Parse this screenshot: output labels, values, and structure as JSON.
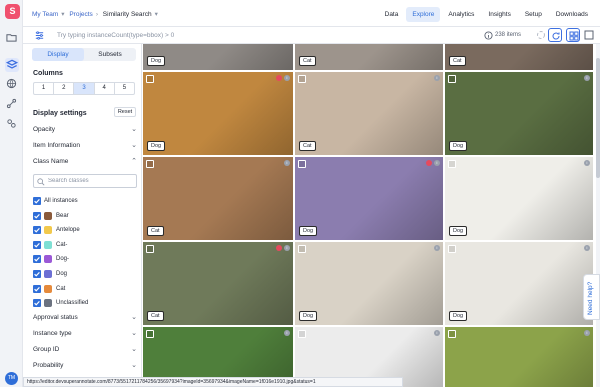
{
  "app": {
    "logo_letter": "S",
    "avatar_initials": "TM"
  },
  "rail": {
    "icons": [
      "folder-icon",
      "layers-icon",
      "globe-icon",
      "workflow-icon",
      "integrations-icon"
    ]
  },
  "breadcrumb": {
    "team": "My Team",
    "projects": "Projects",
    "current": "Similarity Search"
  },
  "tabs": [
    {
      "label": "Data",
      "active": false
    },
    {
      "label": "Explore",
      "active": true
    },
    {
      "label": "Analytics",
      "active": false
    },
    {
      "label": "Insights",
      "active": false
    },
    {
      "label": "Setup",
      "active": false
    },
    {
      "label": "Downloads",
      "active": false
    }
  ],
  "query": {
    "placeholder": "Try typing instanceCount(type=bbox) > 0",
    "item_count": "238 items"
  },
  "panel": {
    "tabs": [
      {
        "label": "Display",
        "active": true
      },
      {
        "label": "Subsets",
        "active": false
      }
    ],
    "columns_heading": "Columns",
    "columns": [
      "1",
      "2",
      "3",
      "4",
      "5"
    ],
    "active_column": "3",
    "display_settings": "Display settings",
    "reset": "Reset",
    "sections": {
      "opacity": "Opacity",
      "item_information": "Item Information",
      "class_name": "Class Name",
      "approval_status": "Approval status",
      "instance_type": "Instance type",
      "group_id": "Group ID",
      "probability": "Probability"
    },
    "search_placeholder": "Search classes",
    "classes": [
      {
        "label": "All instances",
        "color": null
      },
      {
        "label": "Bear",
        "color": "#8a5a3a"
      },
      {
        "label": "Antelope",
        "color": "#f2c94c"
      },
      {
        "label": "Cat-",
        "color": "#7fe0d4"
      },
      {
        "label": "Dog-",
        "color": "#9b59d6"
      },
      {
        "label": "Dog",
        "color": "#6c6fd4"
      },
      {
        "label": "Cat",
        "color": "#e58a3c"
      },
      {
        "label": "Unclassified",
        "color": "#6b7280"
      }
    ]
  },
  "grid": {
    "rows": [
      [
        {
          "label": "Dog",
          "bg": "#8f8a86",
          "annot": false
        },
        {
          "label": "Cat",
          "bg": "#9d948c",
          "annot": false
        },
        {
          "label": "Cat",
          "bg": "#7a6a5e",
          "annot": false
        }
      ],
      [
        {
          "label": "Dog",
          "bg": "#c0873f",
          "annot": true
        },
        {
          "label": "Cat",
          "bg": "#c8b6a3",
          "annot": false
        },
        {
          "label": "Dog",
          "bg": "#5a6e42",
          "annot": false
        }
      ],
      [
        {
          "label": "Cat",
          "bg": "#a57953",
          "annot": false
        },
        {
          "label": "Dog",
          "bg": "#8b7daf",
          "annot": true
        },
        {
          "label": "Dog",
          "bg": "#efeee9",
          "annot": false
        }
      ],
      [
        {
          "label": "Cat",
          "bg": "#6f7a5a",
          "annot": true
        },
        {
          "label": "Dog",
          "bg": "#d9d2c6",
          "annot": false
        },
        {
          "label": "Dog",
          "bg": "#e9e7e1",
          "annot": false
        }
      ],
      [
        {
          "label": "",
          "bg": "#4f7f3b",
          "annot": false
        },
        {
          "label": "",
          "bg": "#ececec",
          "annot": false
        },
        {
          "label": "",
          "bg": "#8ca34a",
          "annot": false
        }
      ]
    ]
  },
  "help": "Need help?",
  "status_url": "https://editor.devsuperannotate.com/8773/5517211784256/35697934?imageId=35697934&imageName=1f016e1910.jpg&status=1"
}
